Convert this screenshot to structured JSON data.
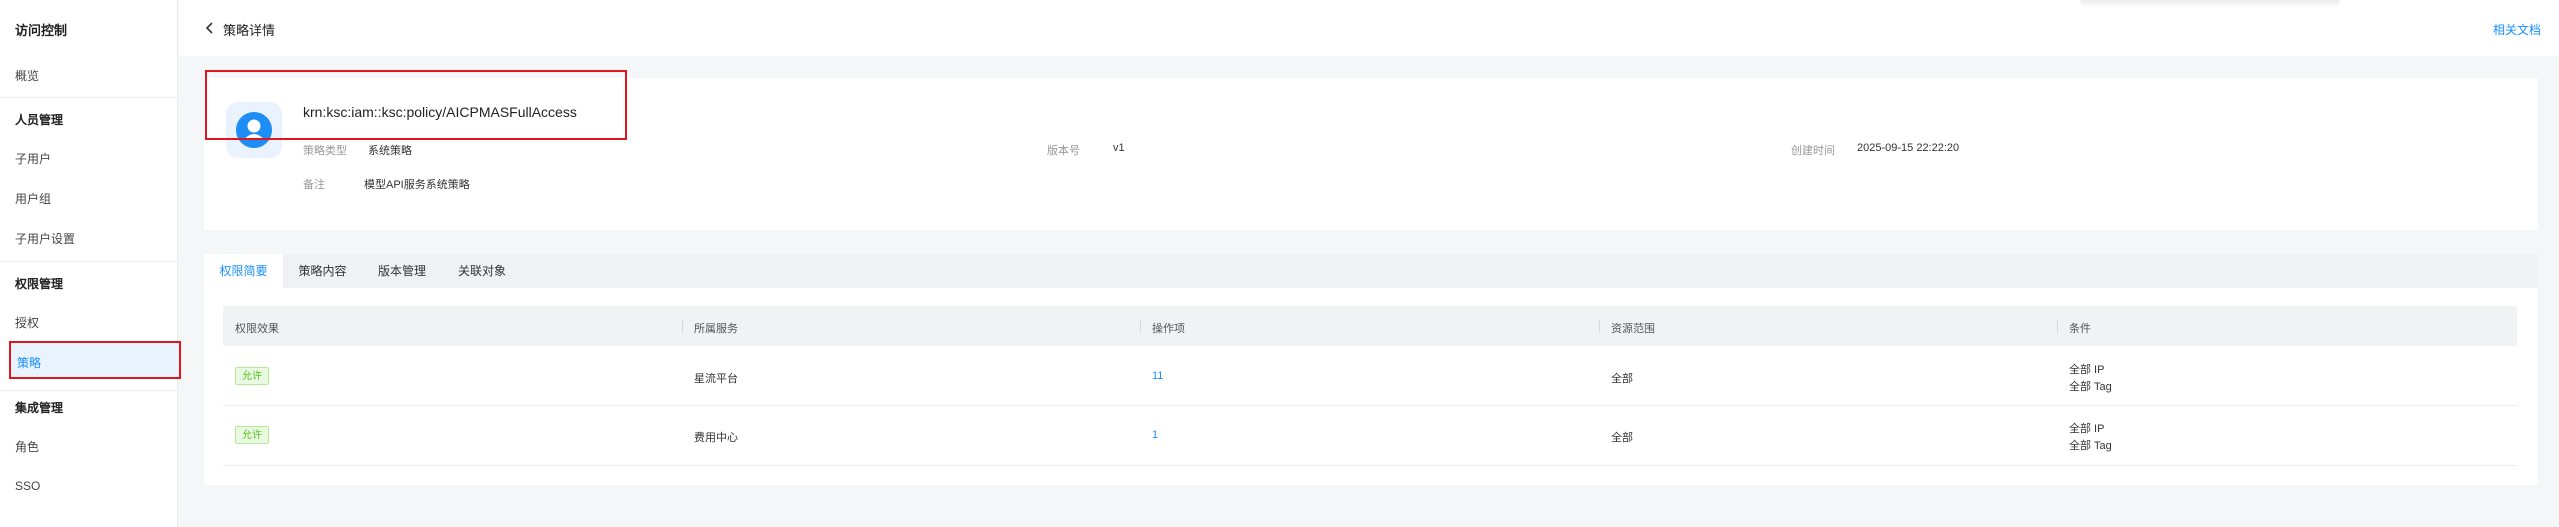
{
  "sidebar": {
    "title": "访问控制",
    "overview": "概览",
    "groups": [
      {
        "label": "人员管理",
        "items": [
          "子用户",
          "用户组",
          "子用户设置"
        ]
      },
      {
        "label": "权限管理",
        "items": [
          "授权",
          "策略"
        ]
      },
      {
        "label": "集成管理",
        "items": [
          "角色",
          "SSO"
        ]
      }
    ],
    "active_item": "策略"
  },
  "header": {
    "title": "策略详情",
    "doc_link": "相关文档"
  },
  "policy": {
    "name": "krn:ksc:iam::ksc:policy/AICPMASFullAccess",
    "type_label": "策略类型",
    "type_value": "系统策略",
    "version_label": "版本号",
    "version_value": "v1",
    "created_label": "创建时间",
    "created_value": "2025-09-15 22:22:20",
    "remark_label": "备注",
    "remark_value": "模型API服务系统策略"
  },
  "tabs": [
    "权限简要",
    "策略内容",
    "版本管理",
    "关联对象"
  ],
  "active_tab": "权限简要",
  "table": {
    "columns": [
      "权限效果",
      "所属服务",
      "操作项",
      "资源范围",
      "条件"
    ],
    "rows": [
      {
        "effect": "允许",
        "service": "星流平台",
        "actions": "11",
        "resource": "全部",
        "condition_ip": "全部 IP",
        "condition_tag": "全部 Tag"
      },
      {
        "effect": "允许",
        "service": "费用中心",
        "actions": "1",
        "resource": "全部",
        "condition_ip": "全部 IP",
        "condition_tag": "全部 Tag"
      }
    ]
  },
  "colors": {
    "accent": "#1890ff",
    "highlight_border": "#e0161d",
    "allow_green": "#52c41a"
  }
}
